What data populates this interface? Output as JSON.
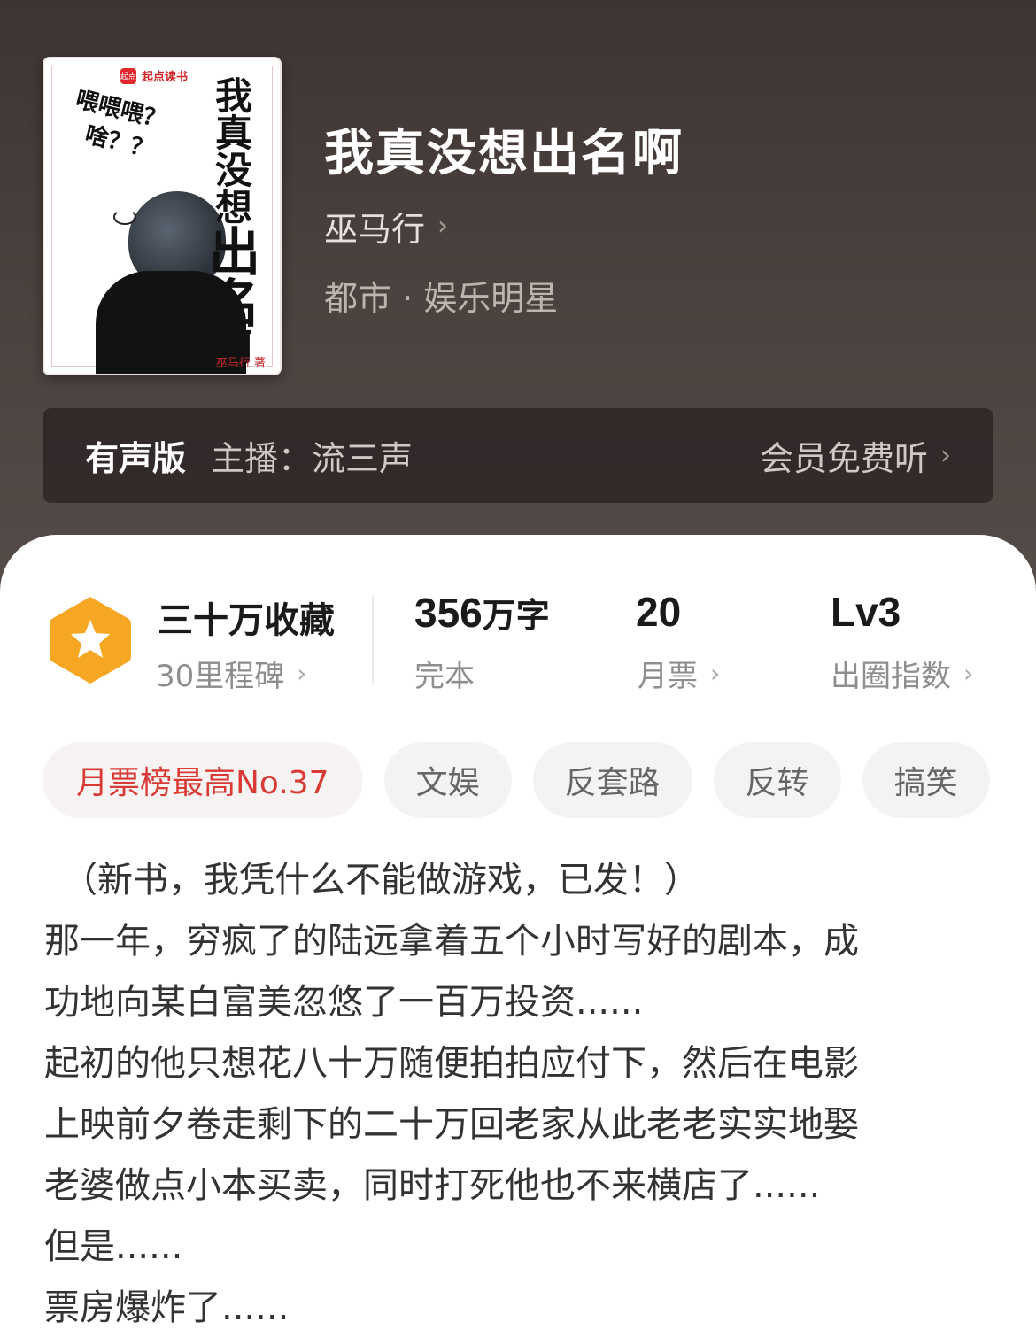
{
  "book": {
    "title": "我真没想出名啊",
    "author": "巫马行",
    "genre": "都市 · 娱乐明星"
  },
  "cover": {
    "brand": "起点读书",
    "brand_logo": "起点",
    "scribble_line1": "喂喂喂？",
    "scribble_line2": "啥？？",
    "title_part1": "我真没想",
    "title_part2": "出名",
    "title_part3": "啊",
    "author_credit": "巫马行 著"
  },
  "audio": {
    "label": "有声版",
    "host": "主播：流三声",
    "cta": "会员免费听"
  },
  "stats": {
    "collect_main": "三十万收藏",
    "collect_sub": "30里程碑",
    "words_num": "356",
    "words_unit": "万字",
    "words_sub": "完本",
    "ticket_num": "20",
    "ticket_sub": "月票",
    "level_num": "Lv3",
    "level_sub": "出圈指数"
  },
  "tags": [
    "月票榜最高No.37",
    "文娱",
    "反套路",
    "反转",
    "搞笑"
  ],
  "description": [
    "（新书，我凭什么不能做游戏，已发！）",
    "那一年，穷疯了的陆远拿着五个小时写好的剧本，成",
    "功地向某白富美忽悠了一百万投资......",
    "起初的他只想花八十万随便拍拍应付下，然后在电影",
    "上映前夕卷走剩下的二十万回老家从此老老实实地娶",
    "老婆做点小本买卖，同时打死他也不来横店了......",
    "但是......",
    "票房爆炸了......"
  ],
  "icons": {
    "badge": "star-hexagon-icon",
    "chevron": "chevron-right-icon"
  },
  "colors": {
    "hero_bg": "#4a403d",
    "badge_orange": "#f5a623",
    "hot_tag": "#d93a35"
  }
}
